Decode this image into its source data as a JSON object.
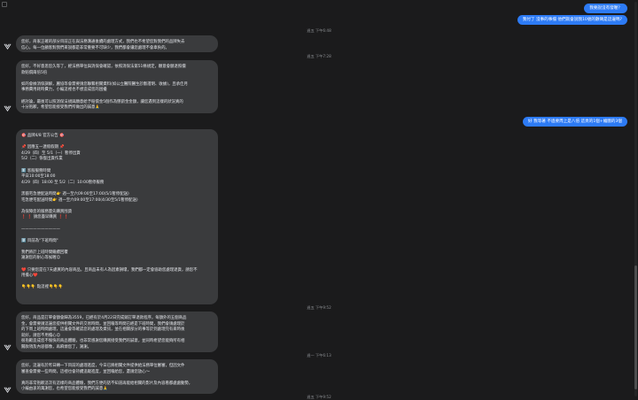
{
  "messages_out": [
    {
      "text": "我要說沒有發喔？"
    },
    {
      "text": "我付了 沒事的事擋 他們就會說我10號的數碼是這邊嗎?"
    },
    {
      "text": "好 我等著 不過要周上是八倍 這頁的1個+繪圖的3個"
    }
  ],
  "timestamps": [
    {
      "text": "週五 下午6:48"
    },
    {
      "text": "週五 下午7:28"
    },
    {
      "text": "週五 下午9:52"
    },
    {
      "text": "週一 下午6:13"
    },
    {
      "text": "週五 下午9:52"
    }
  ],
  "messages_in": [
    {
      "lines": [
        "您好，商家正確的部分目前正在與法務溝通後續的處理方式，我們也不希望您對我們的品牌失去",
        "信心，每一位顧客對我們來說都是非常重要不可缺少，我們都會讓您處理不會辜負的。"
      ]
    },
    {
      "lines": [
        "您好，不好意思您久等了，經法務單位與消保會確認，依照消保法第51條規定，願意會額退照價",
        "款賠償兩倍5倍",
        "",
        "如的會據消保調解，麗協等會需要請您聯繫相關資料(如公立醫院醫生診斷證明、收據)，且承佳月",
        "事務費用耗時費力，小編這裡也不想造成您的困擾",
        "",
        "經討論，最後可以照消保法規與願意給予賠償金5個作為懲罰金金額，讓您遇到這樣的狀況真的",
        "十分抱歉，希望您能接受我們所做出的誠意🙏"
      ]
    },
    {
      "lines": [
        "🎯 品牌4/8 官方公告 🎯",
        "",
        "📌 因應五一連假假期 📌",
        "4/29（四）至 5/1（一）暫停出貨",
        "5/2（二）恢復出貨作業",
        "",
        "1️⃣ 客服服務時間",
        "平日10:00至18:00",
        "4/29（四）18:00 至 5/2（二）10:00暫停服務",
        "",
        "黑貓宅急便配送時間👉 週一至六09:00至17:00(5/1暫停配送)",
        "宅急便宅配送時間👉 週一至六09:00至17:00(4/30至5/1暫停配送)",
        "",
        "為保障您的服務量先購買囤貨",
        "❗ ❗ 請您盡早購買 ❗ ❗",
        "",
        "——————————",
        "",
        "2️⃣ 目前為\"下班時間\"",
        "",
        "我們將於上班時間繼續回覆",
        "謝謝您的耐心等候喔😊",
        "",
        "❤️ 只要您是在7天處買的內容商品，且商品未有人為因素損壞，我們都一定會協助您處理退貨，請您不",
        "用擔心❤️",
        "",
        "👇👇👇 點這裡👇👇👇"
      ]
    },
    {
      "lines": [
        "您好，商品是訂單會額會歸為3559，已經有於4月22日完成銷訂單退款程序，每額外的五個商品",
        "金，會需要請這邊您提供相關文件的交易時間，並回報等時間已經是下班時間，我們會請處理於",
        "的下周上班時間處理，這邊會等確認您的處理及資訊，並在相關部分的事等於到處理完有來時後",
        "就好，請您不用擔心😊",
        "很抱歉造成您不愉快的商品體驗，也非常感謝您購買接受我們的誠意，並同時希望您能夠所有相",
        "關款項及內容都像，再麻煩您了，謝謝。"
      ]
    },
    {
      "lines": [
        "您好，這邊有於昨日轉一下目前的處理進度，今日已將相關文件提供給法務單位審審，但因文件",
        "審查會需要一些時間，這裡也會持續追蹤進度，並回報給您，還請您放心～",
        "",
        "真的非常抱歉這次有這樣的商品體驗，我們方便的話不知道再能給相關的影片及內容看都處處動勢，",
        "小編由衷的萬謝您，也希望您能接受我們的誠意🙏"
      ]
    }
  ]
}
